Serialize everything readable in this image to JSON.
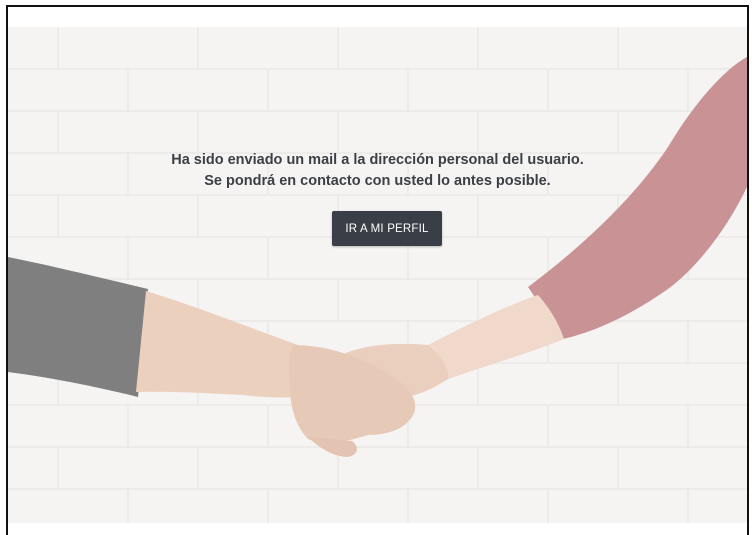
{
  "hero": {
    "message_line1": "Ha sido enviado un mail a la dirección  personal del usuario.",
    "message_line2": "Se pondrá en contacto con usted lo antes posible.",
    "button_label": "IR A MI PERFIL"
  },
  "colors": {
    "button_bg": "#3a3e47",
    "text": "#3b3f46",
    "left_sleeve": "#4d4d4f",
    "right_sleeve": "#b4686c",
    "skin": "#e8c3ad"
  }
}
